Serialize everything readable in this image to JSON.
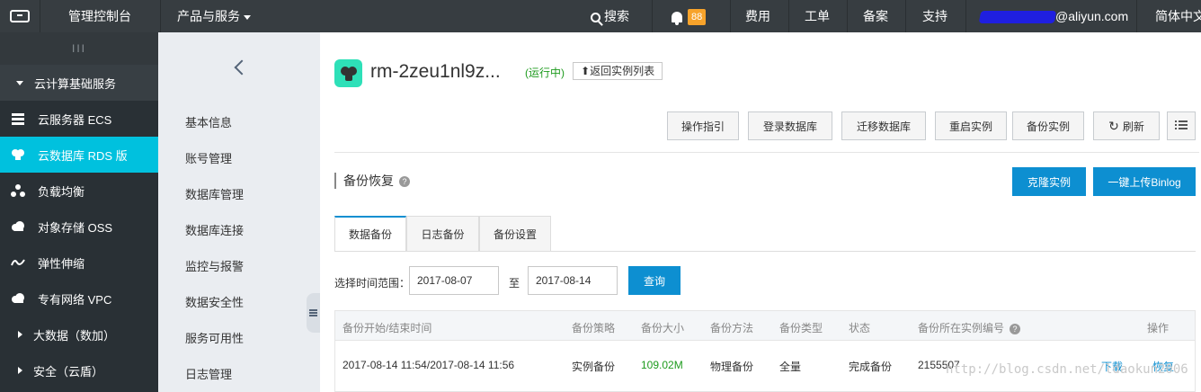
{
  "topbar": {
    "console": "管理控制台",
    "products": "产品与服务",
    "search": "搜索",
    "notifications": "88",
    "billing": "费用",
    "tickets": "工单",
    "icp": "备案",
    "support": "支持",
    "account": "@aliyun.com",
    "language": "简体中文"
  },
  "sidebar": {
    "handle": "III",
    "section": "云计算基础服务",
    "items": [
      {
        "label": "云服务器 ECS",
        "icon": "server-icon"
      },
      {
        "label": "云数据库 RDS 版",
        "icon": "database-icon"
      },
      {
        "label": "负载均衡",
        "icon": "load-balancer-icon"
      },
      {
        "label": "对象存储 OSS",
        "icon": "cloud-storage-icon"
      },
      {
        "label": "弹性伸缩",
        "icon": "autoscale-icon"
      },
      {
        "label": "专有网络 VPC",
        "icon": "cloud-network-icon"
      }
    ],
    "groups": [
      "大数据（数加）",
      "安全（云盾）"
    ]
  },
  "subnav": {
    "items": [
      "基本信息",
      "账号管理",
      "数据库管理",
      "数据库连接",
      "监控与报警",
      "数据安全性",
      "服务可用性",
      "日志管理"
    ]
  },
  "instance": {
    "name": "rm-2zeu1nl9z...",
    "status": "(运行中)",
    "back": "返回实例列表"
  },
  "toolbar": [
    "操作指引",
    "登录数据库",
    "迁移数据库",
    "重启实例",
    "备份实例",
    "刷新"
  ],
  "section": {
    "title": "备份恢复",
    "clone": "克隆实例",
    "upload_binlog": "一键上传Binlog"
  },
  "tabs": [
    "数据备份",
    "日志备份",
    "备份设置"
  ],
  "filter": {
    "label": "选择时间范围：",
    "start": "2017-08-07",
    "to": "至",
    "end": "2017-08-14",
    "query": "查询"
  },
  "table": {
    "headers": [
      "备份开始/结束时间",
      "备份策略",
      "备份大小",
      "备份方法",
      "备份类型",
      "状态",
      "备份所在实例编号",
      "操作"
    ],
    "rows": [
      {
        "time": "2017-08-14 11:54/2017-08-14 11:56",
        "policy": "实例备份",
        "size": "109.02M",
        "method": "物理备份",
        "type": "全量",
        "status": "完成备份",
        "instance_id": "2155507",
        "download": "下载",
        "restore": "恢复"
      }
    ]
  },
  "watermark": "http://blog.csdn.net/ldaokun2006"
}
